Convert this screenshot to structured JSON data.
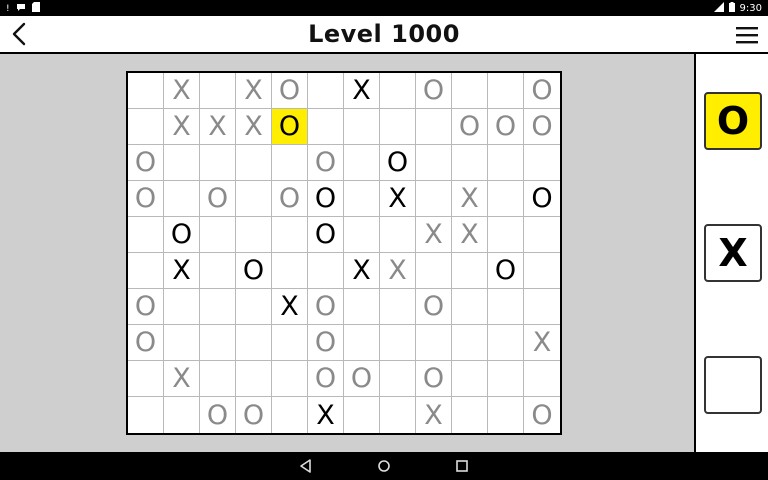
{
  "status_bar": {
    "time": "9:30",
    "left_icons": [
      "alert-icon",
      "chat-icon",
      "sd-card-icon"
    ],
    "right_icons": [
      "signal-icon",
      "battery-icon"
    ]
  },
  "header": {
    "title": "Level 1000",
    "back_icon": "chevron-left-icon",
    "menu_icon": "hamburger-menu-icon"
  },
  "board": {
    "rows": 10,
    "cols": 12,
    "highlight_cell": [
      1,
      4
    ],
    "cells": [
      [
        "",
        "X*",
        "",
        "X*",
        "O*",
        "",
        "X",
        "",
        "O*",
        "",
        "",
        "O*"
      ],
      [
        "",
        "X*",
        "X*",
        "X*",
        "O",
        "",
        "",
        "",
        "",
        "O*",
        "O*",
        "O*"
      ],
      [
        "O*",
        "",
        "",
        "",
        "",
        "O*",
        "",
        "O",
        "",
        "",
        "",
        ""
      ],
      [
        "O*",
        "",
        "O*",
        "",
        "O*",
        "O",
        "",
        "X",
        "",
        "X*",
        "",
        "O"
      ],
      [
        "",
        "O",
        "",
        "",
        "",
        "O",
        "",
        "",
        "X*",
        "X*",
        "",
        ""
      ],
      [
        "",
        "X",
        "",
        "O",
        "",
        "",
        "X",
        "X*",
        "",
        "",
        "O",
        ""
      ],
      [
        "O*",
        "",
        "",
        "",
        "X",
        "O*",
        "",
        "",
        "O*",
        "",
        "",
        ""
      ],
      [
        "O*",
        "",
        "",
        "",
        "",
        "O*",
        "",
        "",
        "",
        "",
        "",
        "X*"
      ],
      [
        "",
        "X*",
        "",
        "",
        "",
        "O*",
        "O*",
        "",
        "O*",
        "",
        "",
        ""
      ],
      [
        "",
        "",
        "O*",
        "O*",
        "",
        "X",
        "",
        "",
        "X*",
        "",
        "",
        "O*"
      ]
    ]
  },
  "side_panel": {
    "buttons": [
      {
        "label": "O",
        "selected": true
      },
      {
        "label": "X",
        "selected": false
      },
      {
        "label": "",
        "selected": false
      }
    ]
  },
  "nav_bar": {
    "icons": [
      "back-triangle-icon",
      "home-circle-icon",
      "recents-square-icon"
    ]
  },
  "colors": {
    "highlight": "#ffee00",
    "given_mark": "#000000",
    "placed_mark": "#8a8a8a",
    "background": "#cfcfcf"
  }
}
